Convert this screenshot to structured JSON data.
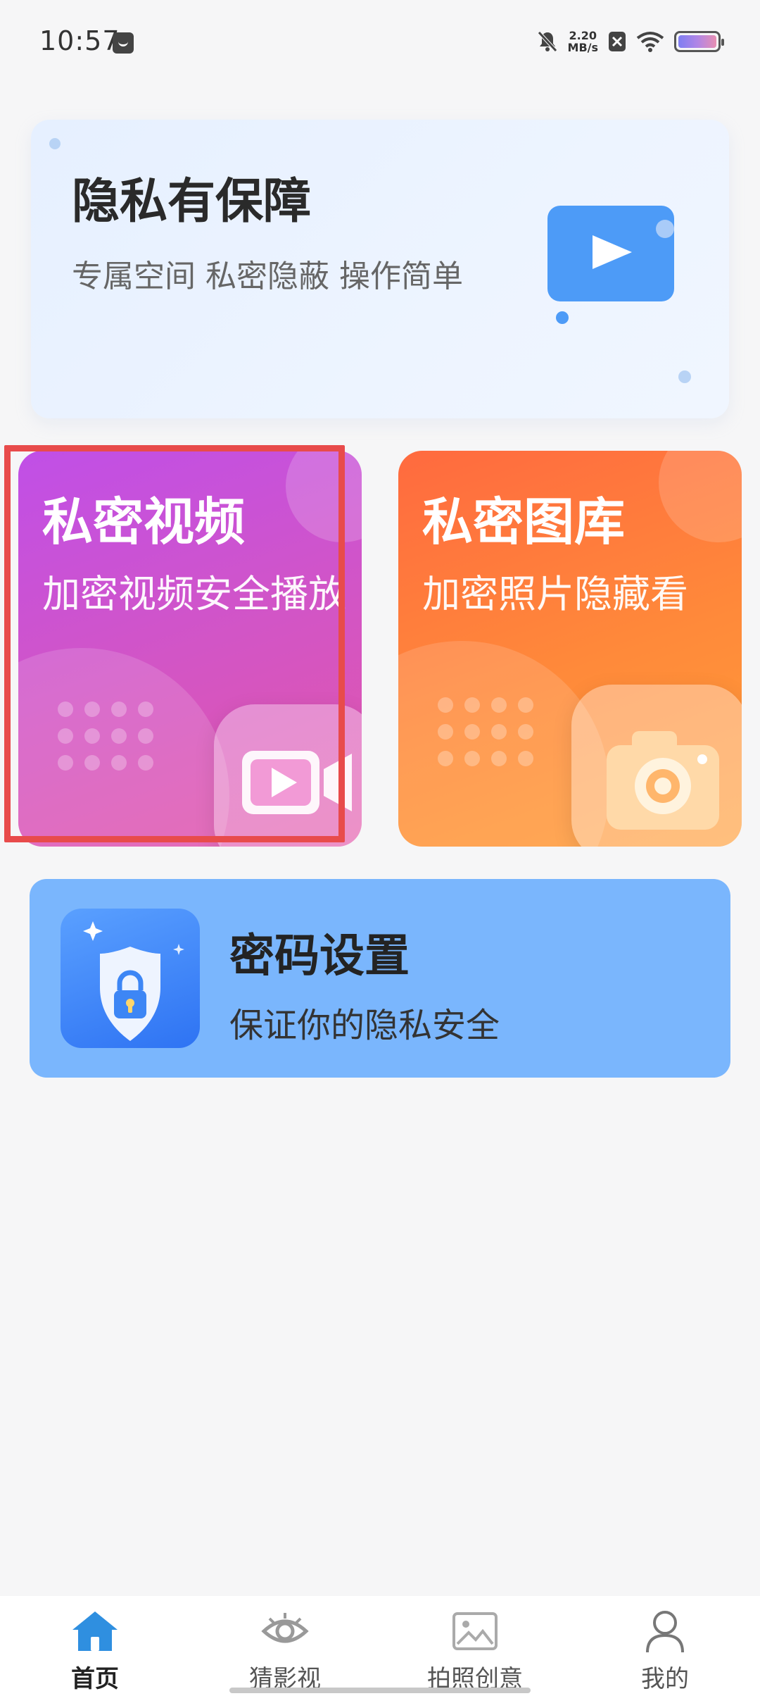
{
  "status_bar": {
    "time": "10:57",
    "net_speed_value": "2.20",
    "net_speed_unit": "MB/s"
  },
  "banner": {
    "title": "隐私有保障",
    "subtitle": "专属空间 私密隐蔽 操作简单"
  },
  "cards": {
    "video": {
      "title": "私密视频",
      "subtitle": "加密视频安全播放"
    },
    "gallery": {
      "title": "私密图库",
      "subtitle": "加密照片隐藏看"
    }
  },
  "password": {
    "title": "密码设置",
    "subtitle": "保证你的隐私安全"
  },
  "nav": {
    "items": [
      {
        "label": "首页",
        "icon": "home-icon",
        "active": true
      },
      {
        "label": "猜影视",
        "icon": "eye-icon",
        "active": false
      },
      {
        "label": "拍照创意",
        "icon": "image-icon",
        "active": false
      },
      {
        "label": "我的",
        "icon": "person-icon",
        "active": false
      }
    ]
  },
  "colors": {
    "accent_blue": "#4d9bf7",
    "video_card": "#c04fe7",
    "gallery_card": "#ff7a3c",
    "password_card": "#7ab6fd",
    "highlight": "#e84b4b"
  }
}
